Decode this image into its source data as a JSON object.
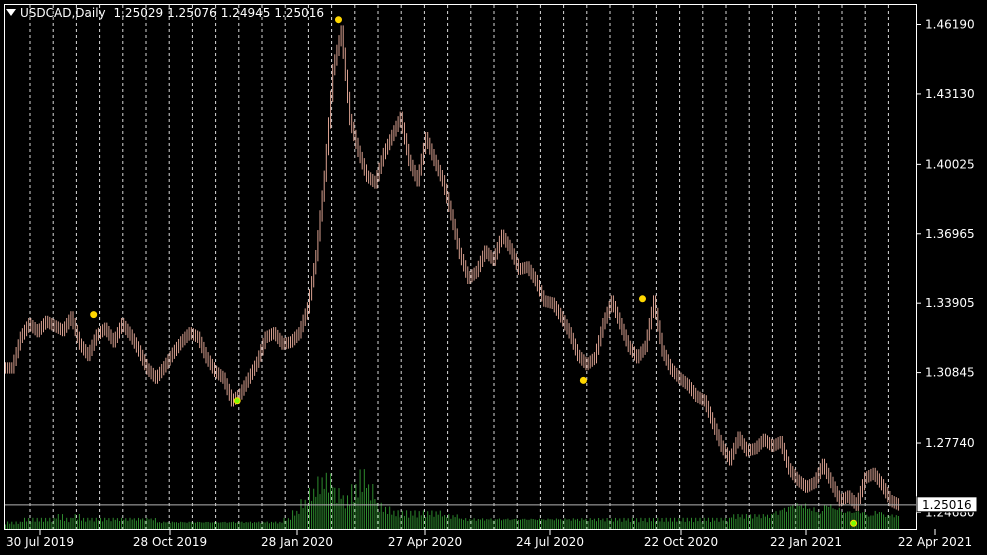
{
  "header": {
    "symbol_timeframe": "USDCAD,Daily",
    "open": "1.25029",
    "high": "1.25076",
    "low": "1.24945",
    "close": "1.25016"
  },
  "colors": {
    "background": "#000000",
    "candle": "#d9a090",
    "volume": "#2e8b2e",
    "grid": "#ffffff",
    "fractal_marker": "#ffd700",
    "fractal_marker_green": "#7cfc00",
    "price_line": "#b4b4b4"
  },
  "chart_data": {
    "type": "line",
    "title": "",
    "symbol": "USDCAD",
    "timeframe": "Daily",
    "y_ticks": [
      "1.46190",
      "1.43130",
      "1.40025",
      "1.36965",
      "1.33905",
      "1.30845",
      "1.27740",
      "1.24680"
    ],
    "y_tick_values": [
      1.4619,
      1.4313,
      1.40025,
      1.36965,
      1.33905,
      1.30845,
      1.2774,
      1.2468
    ],
    "ylim": [
      1.2395,
      1.4705
    ],
    "x_ticks": [
      "30 Jul 2019",
      "28 Oct 2019",
      "28 Jan 2020",
      "27 Apr 2020",
      "24 Jul 2020",
      "22 Oct 2020",
      "22 Jan 2021",
      "22 Apr 2021"
    ],
    "current_price": "1.25016",
    "grid": true,
    "series": [
      {
        "kind": "close",
        "values": [
          1.3105,
          1.324,
          1.33,
          1.3265,
          1.331,
          1.329,
          1.327,
          1.333,
          1.321,
          1.316,
          1.325,
          1.328,
          1.322,
          1.33,
          1.325,
          1.318,
          1.31,
          1.306,
          1.311,
          1.317,
          1.322,
          1.326,
          1.324,
          1.315,
          1.309,
          1.306,
          1.296,
          1.299,
          1.306,
          1.313,
          1.324,
          1.326,
          1.321,
          1.322,
          1.326,
          1.337,
          1.36,
          1.395,
          1.442,
          1.459,
          1.42,
          1.406,
          1.395,
          1.392,
          1.405,
          1.413,
          1.421,
          1.402,
          1.393,
          1.412,
          1.402,
          1.393,
          1.378,
          1.361,
          1.35,
          1.353,
          1.362,
          1.358,
          1.369,
          1.363,
          1.354,
          1.355,
          1.349,
          1.34,
          1.339,
          1.333,
          1.326,
          1.316,
          1.312,
          1.315,
          1.33,
          1.34,
          1.33,
          1.32,
          1.315,
          1.32,
          1.34,
          1.318,
          1.31,
          1.306,
          1.303,
          1.298,
          1.296,
          1.286,
          1.276,
          1.27,
          1.28,
          1.274,
          1.275,
          1.279,
          1.276,
          1.278,
          1.266,
          1.261,
          1.258,
          1.26,
          1.268,
          1.26,
          1.252,
          1.254,
          1.25,
          1.262,
          1.264,
          1.259,
          1.252,
          1.2501
        ]
      },
      {
        "kind": "volume",
        "values": [
          2,
          2,
          3,
          3,
          3,
          3,
          4,
          3,
          4,
          3,
          3,
          3,
          3,
          3,
          3,
          3,
          3,
          3,
          2,
          2,
          2,
          2,
          2,
          2,
          2,
          2,
          2,
          2,
          2,
          2,
          2,
          2,
          2,
          3,
          5,
          8,
          11,
          14,
          15,
          11,
          9,
          12,
          16,
          12,
          7,
          6,
          5,
          5,
          5,
          5,
          5,
          5,
          4,
          4,
          3,
          3,
          3,
          3,
          3,
          3,
          3,
          3,
          3,
          3,
          3,
          3,
          3,
          3,
          3,
          3,
          3,
          3,
          3,
          3,
          3,
          3,
          3,
          3,
          3,
          3,
          3,
          3,
          3,
          3,
          3,
          3,
          4,
          4,
          4,
          4,
          4,
          5,
          6,
          7,
          7,
          6,
          5,
          7,
          6,
          5,
          5,
          5,
          4,
          5,
          4,
          4
        ]
      }
    ],
    "fractal_markers": [
      {
        "index": 10,
        "price": 1.334,
        "color": "yellow"
      },
      {
        "index": 27,
        "price": 1.296,
        "color": "green"
      },
      {
        "index": 39,
        "price": 1.464,
        "color": "yellow"
      },
      {
        "index": 68,
        "price": 1.305,
        "color": "yellow"
      },
      {
        "index": 75,
        "price": 1.341,
        "color": "yellow"
      },
      {
        "index": 100,
        "price": 1.242,
        "color": "green"
      }
    ]
  }
}
